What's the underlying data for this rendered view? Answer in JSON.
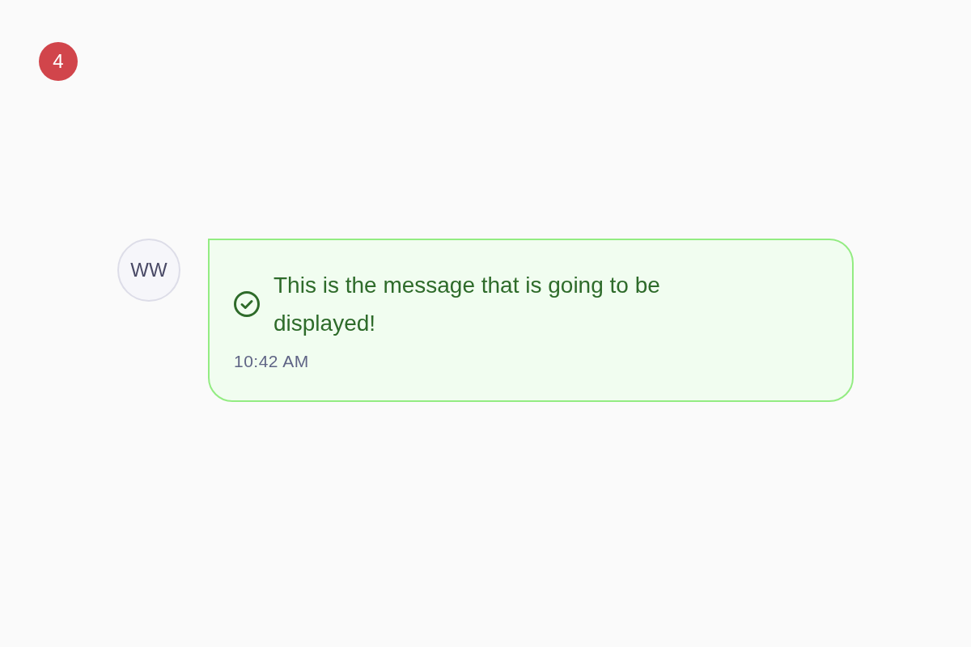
{
  "notification_badge": {
    "count": "4"
  },
  "message": {
    "kind": "success",
    "avatar_initials": "WW",
    "text": "This is the message that is going to be displayed!",
    "time": "10:42 AM"
  }
}
